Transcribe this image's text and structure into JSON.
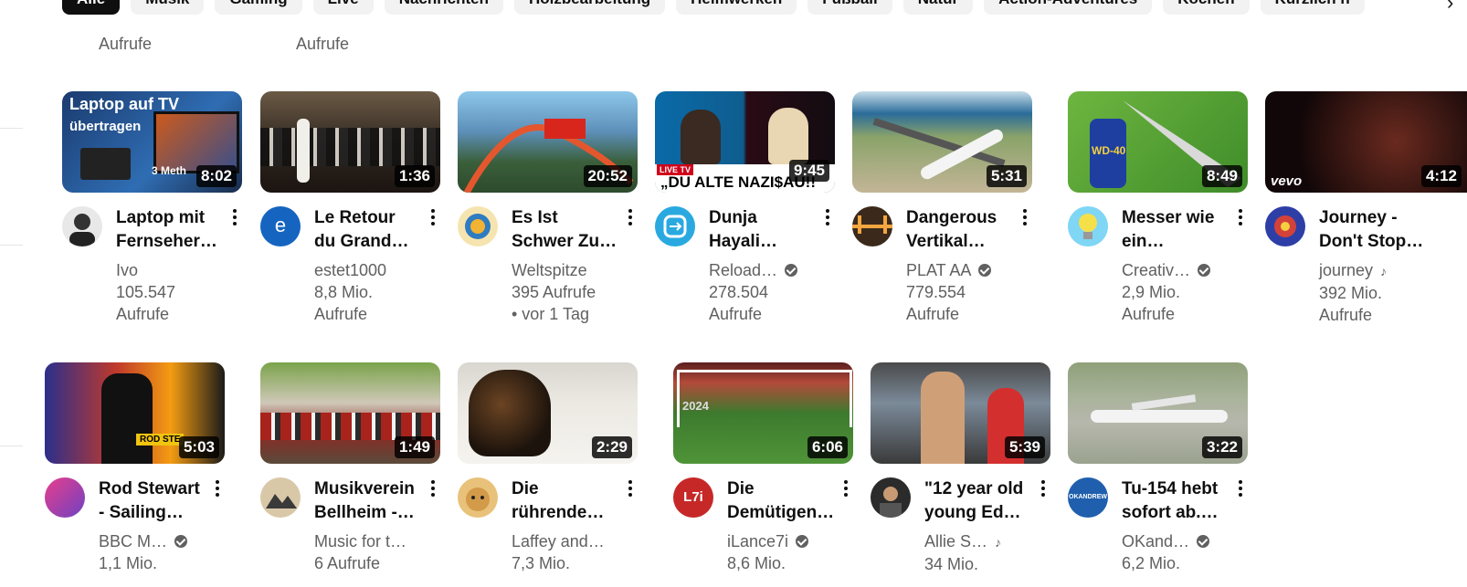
{
  "chips": [
    "Alle",
    "Musik",
    "Gaming",
    "Live",
    "Nachrichten",
    "Holzbearbeitung",
    "Heimwerken",
    "Fußball",
    "Natur",
    "Action-Adventures",
    "Kochen",
    "Kürzlich h"
  ],
  "prev_meta": [
    "Aufrufe",
    "Aufrufe"
  ],
  "row1": [
    {
      "title1": "Laptop mit",
      "title2": "Fernseher…",
      "channel": "Ivo",
      "views": "105.547",
      "views2": "Aufrufe",
      "duration": "8:02",
      "badge": "",
      "overlay1": "Laptop auf TV",
      "overlay2": "übertragen",
      "overlay3": "3 Meth"
    },
    {
      "title1": "Le Retour",
      "title2": "du Grand…",
      "channel": "estet1000",
      "views": "8,8 Mio.",
      "views2": "Aufrufe",
      "duration": "1:36",
      "badge": "",
      "avatar_letter": "e"
    },
    {
      "title1": "Es Ist",
      "title2": "Schwer Zu…",
      "channel": "Weltspitze",
      "views": "395 Aufrufe",
      "views2": " • vor 1 Tag",
      "duration": "20:52",
      "badge": ""
    },
    {
      "title1": "Dunja",
      "title2": "Hayali…",
      "channel": "Reload…",
      "views": "278.504",
      "views2": "Aufrufe",
      "duration": "9:45",
      "badge": "verified",
      "overlay1": "LIVE TV",
      "overlay2": "„DU ALTE NAZI$AU!!"
    },
    {
      "title1": "Dangerous",
      "title2": "Vertikal…",
      "channel": "PLAT AA",
      "views": "779.554",
      "views2": "Aufrufe",
      "duration": "5:31",
      "badge": "verified"
    },
    {
      "title1": "Messer wie",
      "title2": "ein…",
      "channel": "Creativ…",
      "views": "2,9 Mio.",
      "views2": "Aufrufe",
      "duration": "8:49",
      "badge": "verified",
      "overlay1": "WD-40"
    },
    {
      "title1": "Journey -",
      "title2": "Don't Stop…",
      "channel": "journey",
      "views": "392 Mio.",
      "views2": "Aufrufe",
      "duration": "4:12",
      "badge": "music",
      "overlay1": "vevo"
    }
  ],
  "row2": [
    {
      "title1": "Rod Stewart",
      "title2": "- Sailing…",
      "channel": "BBC M…",
      "views": "1,1 Mio.",
      "duration": "5:03",
      "badge": "verified",
      "overlay1": "ROD STE"
    },
    {
      "title1": "Musikverein",
      "title2": "Bellheim -…",
      "channel": "Music for t…",
      "views": "6 Aufrufe",
      "duration": "1:49",
      "badge": ""
    },
    {
      "title1": "Die",
      "title2": "rührende…",
      "channel": "Laffey and…",
      "views": "7,3 Mio.",
      "duration": "2:29",
      "badge": ""
    },
    {
      "title1": "Die",
      "title2": "Demütigen…",
      "channel": "iLance7i",
      "views": "8,6 Mio.",
      "duration": "6:06",
      "badge": "verified",
      "overlay1": "2024",
      "avatar_text": "L7i"
    },
    {
      "title1": "\"12 year old",
      "title2": "young Ed…",
      "channel": "Allie S…",
      "views": "34 Mio.",
      "duration": "5:39",
      "badge": "music"
    },
    {
      "title1": "Tu-154 hebt",
      "title2": "sofort ab.…",
      "channel": "OKand…",
      "views": "6,2 Mio.",
      "duration": "3:22",
      "badge": "verified",
      "avatar_text": "OKANDREW"
    }
  ],
  "colors": {
    "text": "#0f0f0f",
    "secondary": "#606060",
    "chip_bg": "#f2f2f2",
    "chip_active": "#0f0f0f"
  }
}
